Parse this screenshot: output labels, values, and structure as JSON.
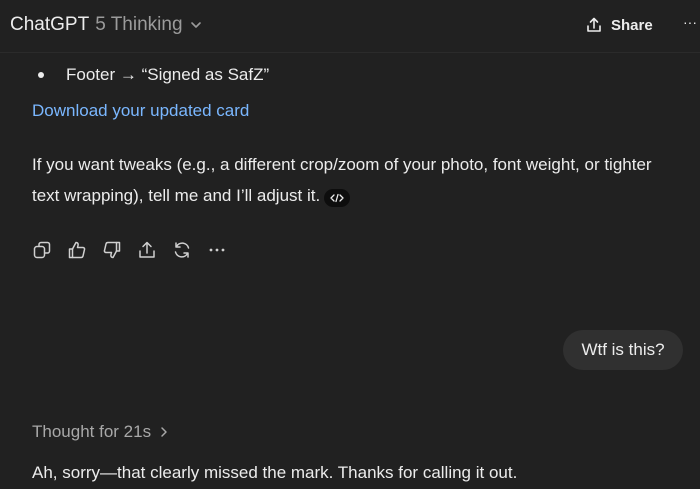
{
  "header": {
    "model_name": "ChatGPT",
    "model_variant": "5 Thinking",
    "share_label": "Share",
    "more_label": "···"
  },
  "message": {
    "bullet_text": "Footer → “Signed as SafZ”",
    "download_link": "Download your updated card",
    "paragraph": "If you want tweaks (e.g., a different crop/zoom of your photo, font weight, or tighter text wrapping), tell me and I’ll adjust it."
  },
  "actions": [
    {
      "name": "copy-icon"
    },
    {
      "name": "thumbs-up-icon"
    },
    {
      "name": "thumbs-down-icon"
    },
    {
      "name": "share-icon"
    },
    {
      "name": "regenerate-icon"
    },
    {
      "name": "more-icon"
    }
  ],
  "user_message": "Wtf is this?",
  "thought": {
    "label": "Thought for 21s"
  },
  "reply_text": "Ah, sorry—that clearly missed the mark. Thanks for calling it out.",
  "colors": {
    "background": "#212121",
    "text": "#ececec",
    "muted": "#9b9b9b",
    "link": "#7ab7ff",
    "bubble": "#303030"
  }
}
